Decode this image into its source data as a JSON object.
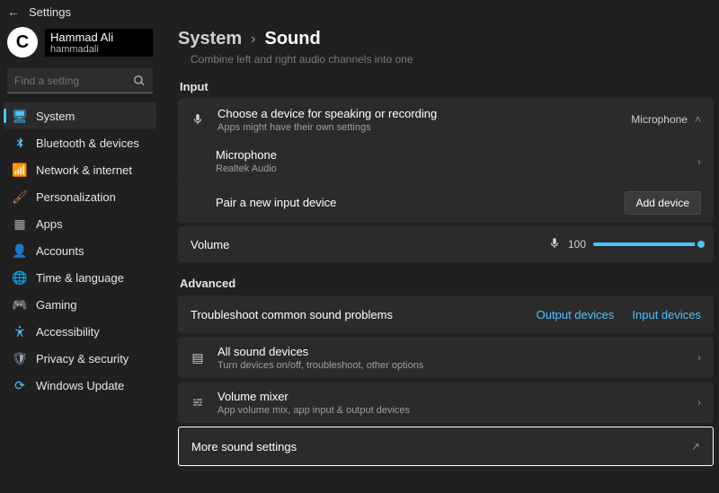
{
  "titlebar": {
    "title": "Settings"
  },
  "user": {
    "name": "Hammad Ali",
    "id": "hammadali"
  },
  "search": {
    "placeholder": "Find a setting"
  },
  "sidebar": {
    "items": [
      {
        "label": "System",
        "icon": "💻",
        "active": true
      },
      {
        "label": "Bluetooth & devices",
        "icon": "bt"
      },
      {
        "label": "Network & internet",
        "icon": "📶"
      },
      {
        "label": "Personalization",
        "icon": "🖌"
      },
      {
        "label": "Apps",
        "icon": "▦"
      },
      {
        "label": "Accounts",
        "icon": "👤"
      },
      {
        "label": "Time & language",
        "icon": "🌐"
      },
      {
        "label": "Gaming",
        "icon": "🎮"
      },
      {
        "label": "Accessibility",
        "icon": "♿"
      },
      {
        "label": "Privacy & security",
        "icon": "🔒"
      },
      {
        "label": "Windows Update",
        "icon": "🔄"
      }
    ]
  },
  "breadcrumb": {
    "parent": "System",
    "current": "Sound"
  },
  "top_fragment": "Combine left and right audio channels into one",
  "input_section": {
    "label": "Input",
    "choose": {
      "title": "Choose a device for speaking or recording",
      "subtitle": "Apps might have their own settings",
      "value": "Microphone"
    },
    "mic": {
      "title": "Microphone",
      "sub": "Realtek Audio"
    },
    "pair": {
      "title": "Pair a new input device",
      "button": "Add device"
    },
    "volume": {
      "title": "Volume",
      "value": "100"
    }
  },
  "advanced_section": {
    "label": "Advanced",
    "troubleshoot": {
      "title": "Troubleshoot common sound problems",
      "link_output": "Output devices",
      "link_input": "Input devices"
    },
    "all": {
      "title": "All sound devices",
      "sub": "Turn devices on/off, troubleshoot, other options"
    },
    "mixer": {
      "title": "Volume mixer",
      "sub": "App volume mix, app input & output devices"
    },
    "more": {
      "title": "More sound settings"
    }
  }
}
